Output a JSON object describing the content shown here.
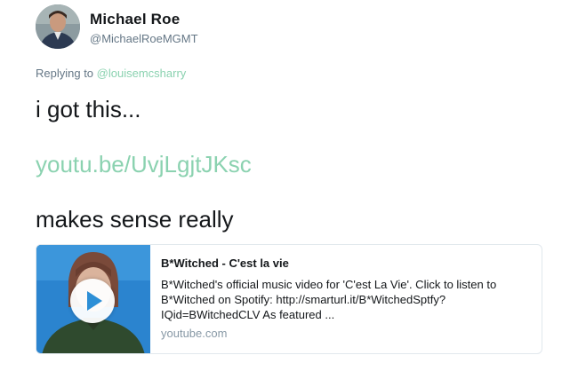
{
  "author": {
    "display_name": "Michael Roe",
    "handle": "@MichaelRoeMGMT",
    "avatar_icon": "user-avatar-photo"
  },
  "reply": {
    "prefix": "Replying to ",
    "mention": "@louisemcsharry"
  },
  "tweet": {
    "line1": "i got this...",
    "link": "youtu.be/UvjLgjtJKsc",
    "line3": "makes sense really"
  },
  "card": {
    "title": "B*Witched - C'est la vie",
    "description": "B*Witched's official music video for 'C'est La Vie'. Click to listen to B*Witched on Spotify: http://smarturl.it/B*WitchedSptfy?IQid=BWitchedCLV As featured ...",
    "domain": "youtube.com",
    "thumbnail_icon": "video-thumbnail",
    "play_icon": "play-icon"
  },
  "colors": {
    "link": "#8bd2b0",
    "secondary_text": "#657786",
    "play_triangle": "#2e8fd6"
  }
}
